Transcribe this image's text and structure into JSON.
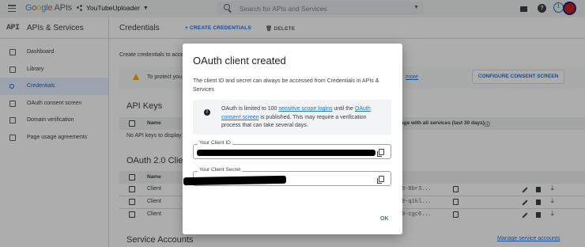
{
  "topbar": {
    "logo_google": [
      "G",
      "o",
      "o",
      "g",
      "l",
      "e"
    ],
    "logo_apis": "APIs",
    "project_name": "YouTubeUploader",
    "search_placeholder": "Search for APIs and Services",
    "notification_count": "1"
  },
  "subbar": {
    "api_label": "API",
    "section_title": "APIs & Services",
    "page_title": "Credentials",
    "create_label": "+ CREATE CREDENTIALS",
    "delete_label": "DELETE"
  },
  "sidebar": {
    "items": [
      {
        "label": "Dashboard"
      },
      {
        "label": "Library"
      },
      {
        "label": "Credentials"
      },
      {
        "label": "OAuth consent screen"
      },
      {
        "label": "Domain verification"
      },
      {
        "label": "Page usage agreements"
      }
    ]
  },
  "main": {
    "intro": "Create credentials to acce",
    "warn_text": "To protect you",
    "learn_more": "more",
    "configure_btn": "CONFIGURE CONSENT SCREEN",
    "api_keys_title": "API Keys",
    "api_keys_col_name": "Name",
    "api_keys_col_usage": "age with all services (last 30 days)",
    "api_keys_empty": "No API keys to display",
    "oauth_title": "OAuth 2.0 Clie",
    "oauth_col_name": "Name",
    "oauth_rows": [
      {
        "name": "Client",
        "client_id": "9-8br3..."
      },
      {
        "name": "Client",
        "client_id": "9-q1kl..."
      },
      {
        "name": "Client",
        "client_id": "9-cgc6..."
      }
    ],
    "service_accounts_title": "Service Accounts",
    "manage_service_accounts": "Manage service accounts"
  },
  "modal": {
    "title": "OAuth client created",
    "description": "The client ID and secret can always be accessed from Credentials in APIs & Services",
    "info_prefix": "OAuth is limited to 100 ",
    "info_link1": "sensitive scope logins",
    "info_mid": " until the ",
    "info_link2": "OAuth consent screen",
    "info_suffix": " is published. This may require a verification process that can take several days.",
    "client_id_label": "Your Client ID",
    "client_secret_label": "Your Client Secret",
    "ok_label": "OK"
  }
}
